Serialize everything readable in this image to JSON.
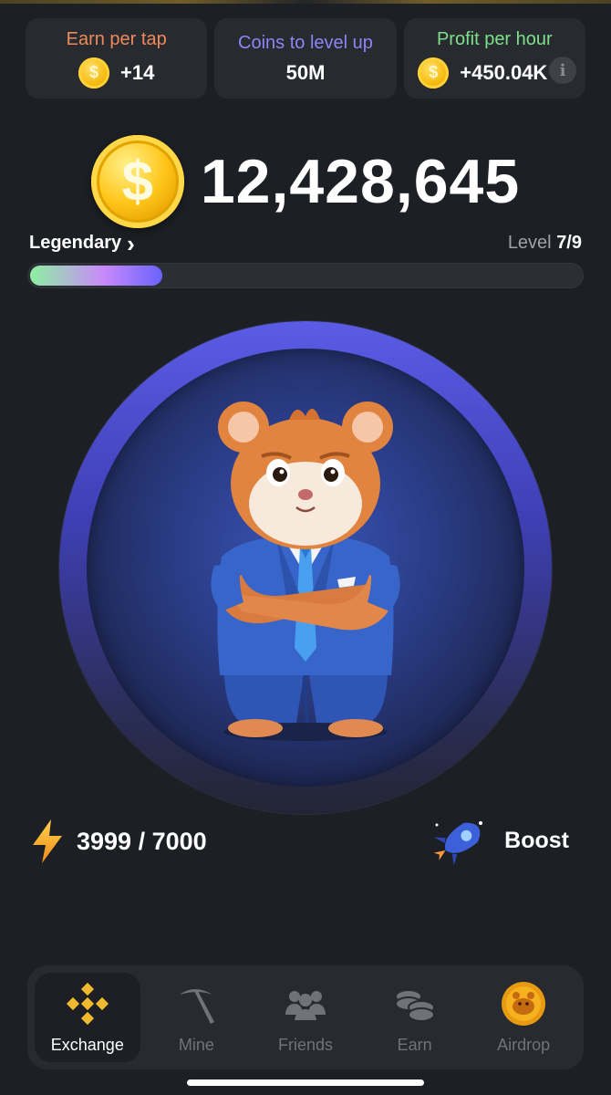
{
  "stats": [
    {
      "label": "Earn per tap",
      "value": "+14",
      "label_color": "#f08a5d",
      "has_coin": true
    },
    {
      "label": "Coins to level up",
      "value": "50M",
      "label_color": "#8b86f5",
      "has_coin": false
    },
    {
      "label": "Profit per hour",
      "value": "+450.04K",
      "label_color": "#7ee08a",
      "has_coin": true
    }
  ],
  "balance": {
    "coin_symbol": "$",
    "value": "12,428,645"
  },
  "level": {
    "rank": "Legendary",
    "rank_chevron": "›",
    "prefix": "Level ",
    "value": "7/9",
    "progress": 0.24
  },
  "energy": {
    "value": "3999 / 7000"
  },
  "boost": {
    "label": "Boost"
  },
  "nav": {
    "items": [
      {
        "label": "Exchange",
        "icon": "binance-icon",
        "active": true
      },
      {
        "label": "Mine",
        "icon": "pickaxe-icon",
        "active": false
      },
      {
        "label": "Friends",
        "icon": "friends-icon",
        "active": false
      },
      {
        "label": "Earn",
        "icon": "coins-stack-icon",
        "active": false
      },
      {
        "label": "Airdrop",
        "icon": "hamster-coin-icon",
        "active": false
      }
    ]
  },
  "colors": {
    "accent_yellow": "#f3ba2f",
    "ring_blue": "#5a5ce6",
    "background": "#1c1f24",
    "card": "#272a2f"
  }
}
